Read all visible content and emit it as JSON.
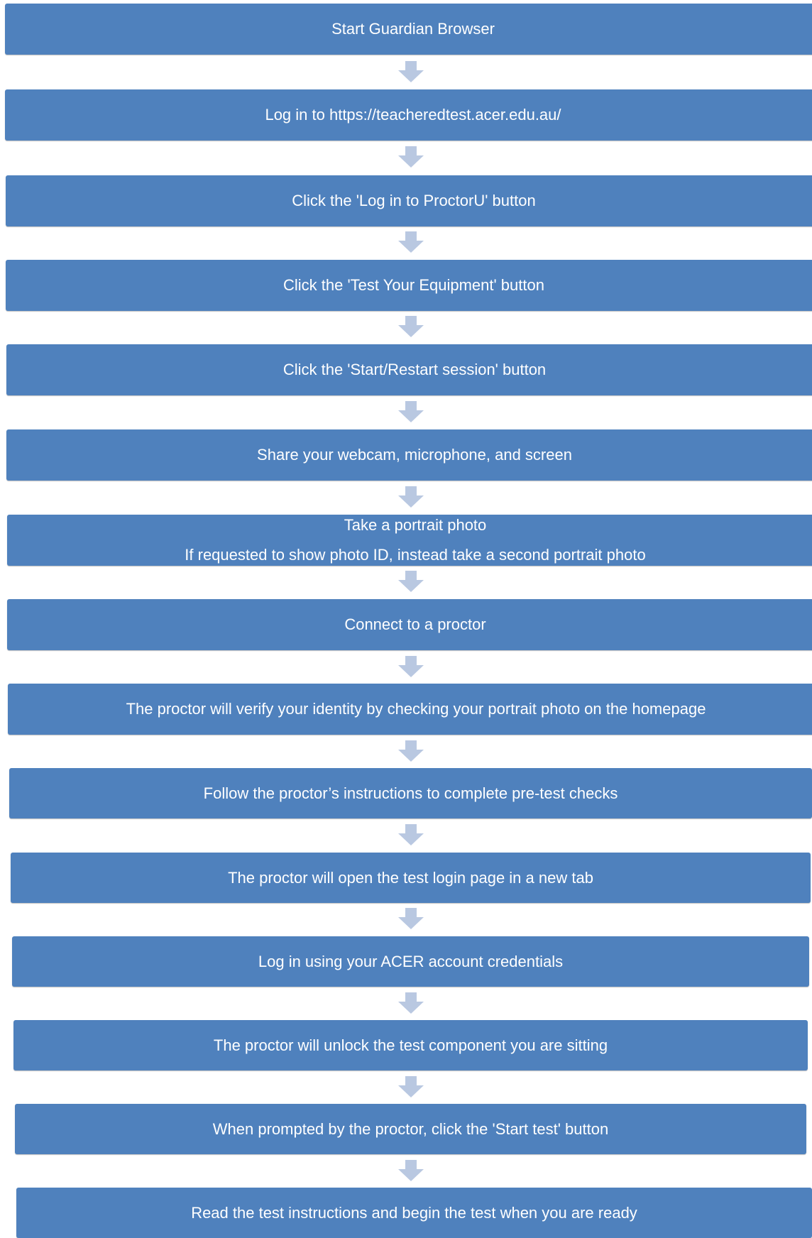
{
  "diagram": {
    "steps": [
      {
        "text": "Start Guardian Browser"
      },
      {
        "text": "Log in to https://teacheredtest.acer.edu.au/"
      },
      {
        "text": "Click the 'Log in to ProctorU' button"
      },
      {
        "text": "Click the 'Test Your Equipment' button"
      },
      {
        "text": "Click the 'Start/Restart session' button"
      },
      {
        "text": "Share your webcam, microphone, and screen"
      },
      {
        "line1": "Take a portrait photo",
        "line2": "If requested to show photo ID, instead take a second portrait photo"
      },
      {
        "text": "Connect to a proctor"
      },
      {
        "text": "The proctor will verify your identity by checking your portrait photo on the homepage"
      },
      {
        "text": "Follow the proctor’s instructions to complete pre-test checks"
      },
      {
        "text": "The proctor will open the test login page in a new tab"
      },
      {
        "text": "Log in using your ACER account credentials"
      },
      {
        "text": "The proctor will unlock the test component you are sitting"
      },
      {
        "text": "When prompted by the proctor, click the 'Start test' button"
      },
      {
        "text": "Read the test instructions and begin the test when you are ready"
      }
    ],
    "colors": {
      "box": "#4f81bd",
      "arrow": "#b9c8e1",
      "text": "#ffffff"
    },
    "arrow_icon": "down-arrow-icon"
  }
}
